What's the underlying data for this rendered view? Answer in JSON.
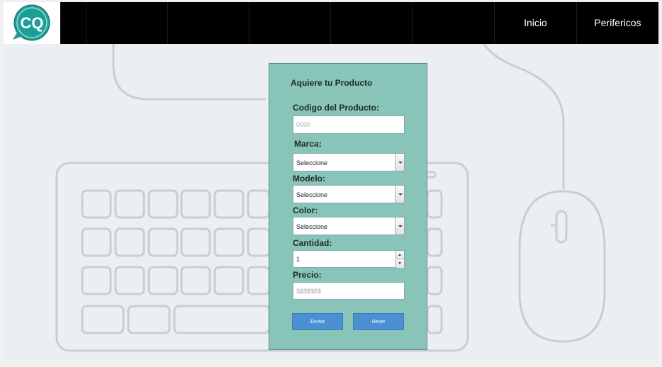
{
  "nav": {
    "logo_letters": "CQ",
    "links": [
      {
        "label": "Inicio"
      },
      {
        "label": "Perifericos"
      }
    ]
  },
  "form": {
    "title": "Aquiere tu Producto",
    "codigo_label": "Codigo del Producto:",
    "codigo_placeholder": "0000",
    "marca_label": "Marca:",
    "marca_value": "Seleccione",
    "modelo_label": "Modelo:",
    "modelo_value": "Seleccione",
    "color_label": "Color:",
    "color_value": "Seleccione",
    "cantidad_label": "Cantidad:",
    "cantidad_value": "1",
    "precio_label": "Precio:",
    "precio_placeholder": "$$$$$$$",
    "submit_label": "Enviar",
    "reset_label": "Reset"
  },
  "colors": {
    "panel": "#88c4b7",
    "button": "#4a90d2",
    "navbar": "#000000",
    "logo_teal": "#1a9e96"
  }
}
